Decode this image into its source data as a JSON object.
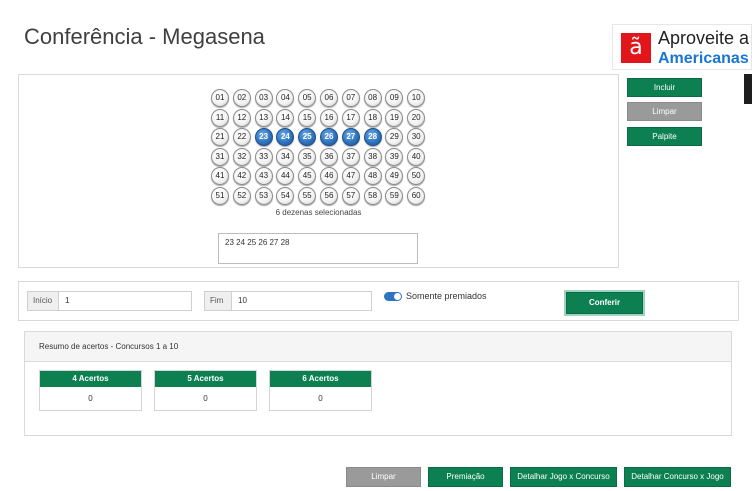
{
  "page": {
    "title": "Conferência - Megasena"
  },
  "ad": {
    "logo_glyph": "ã",
    "line1": "Aproveite a",
    "line2": "Americanas",
    "brand_color": "#e1151a"
  },
  "numbers": {
    "all": [
      "01",
      "02",
      "03",
      "04",
      "05",
      "06",
      "07",
      "08",
      "09",
      "10",
      "11",
      "12",
      "13",
      "14",
      "15",
      "16",
      "17",
      "18",
      "19",
      "20",
      "21",
      "22",
      "23",
      "24",
      "25",
      "26",
      "27",
      "28",
      "29",
      "30",
      "31",
      "32",
      "33",
      "34",
      "35",
      "36",
      "37",
      "38",
      "39",
      "40",
      "41",
      "42",
      "43",
      "44",
      "45",
      "46",
      "47",
      "48",
      "49",
      "50",
      "51",
      "52",
      "53",
      "54",
      "55",
      "56",
      "57",
      "58",
      "59",
      "60"
    ],
    "selected": [
      "23",
      "24",
      "25",
      "26",
      "27",
      "28"
    ],
    "selected_count_text": "6 dezenas selecionadas",
    "selected_text": "23 24 25 26 27 28"
  },
  "side_buttons": {
    "incluir": "Incluir",
    "limpar": "Limpar",
    "palpite": "Palpite"
  },
  "range": {
    "inicio_label": "Início",
    "inicio_value": "1",
    "fim_label": "Fim",
    "fim_value": "10",
    "somente_premiados_label": "Somente premiados",
    "somente_premiados_on": true,
    "conferir_label": "Conferir"
  },
  "results": {
    "header": "Resumo de acertos - Concursos 1 a 10",
    "cards": [
      {
        "label": "4 Acertos",
        "value": "0"
      },
      {
        "label": "5 Acertos",
        "value": "0"
      },
      {
        "label": "6 Acertos",
        "value": "0"
      }
    ]
  },
  "bottom_buttons": {
    "limpar": "Limpar",
    "premiacao": "Premiação",
    "detalhar_jogo": "Detalhar Jogo x Concurso",
    "detalhar_concurso": "Detalhar Concurso x Jogo"
  },
  "colors": {
    "primary_green": "#0c8051",
    "selected_blue": "#2f74c0",
    "gray_button": "#9a9a9a"
  }
}
